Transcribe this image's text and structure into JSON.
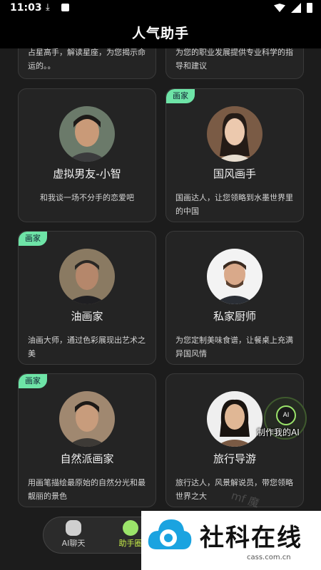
{
  "status_bar": {
    "time": "11:03"
  },
  "header": {
    "title": "人气助手"
  },
  "partial_cards": [
    {
      "desc": "占星高手，解读星座，为您揭示命运的。。"
    },
    {
      "desc": "为您的职业发展提供专业科学的指导和建议"
    }
  ],
  "cards": [
    {
      "name": "虚拟男友-小智",
      "desc": "和我谈一场不分手的恋爱吧",
      "badge": ""
    },
    {
      "name": "国风画手",
      "desc": "国画达人，让您领略到水墨世界里的中国",
      "badge": "画家"
    },
    {
      "name": "油画家",
      "desc": "油画大师，通过色彩展现出艺术之美",
      "badge": "画家"
    },
    {
      "name": "私家厨师",
      "desc": "为您定制美味食谱，让餐桌上充满异国风情",
      "badge": ""
    },
    {
      "name": "自然派画家",
      "desc": "用画笔描绘最原始的自然分光和最靓丽的景色",
      "badge": "画家"
    },
    {
      "name": "旅行导游",
      "desc": "旅行达人，风景解说员，带您领略世界之大",
      "badge": ""
    }
  ],
  "fab": {
    "icon_text": "AI",
    "label": "制作我的AI"
  },
  "bottom_nav": {
    "items": [
      {
        "label": "AI聊天"
      },
      {
        "label": "助手圈"
      }
    ]
  },
  "watermark": "mf 魔",
  "ad": {
    "brand": "社科在线",
    "url": "cass.com.cn"
  },
  "colors": {
    "accent": "#6ee4a7",
    "background": "#1c1c1c",
    "card": "#242424"
  }
}
